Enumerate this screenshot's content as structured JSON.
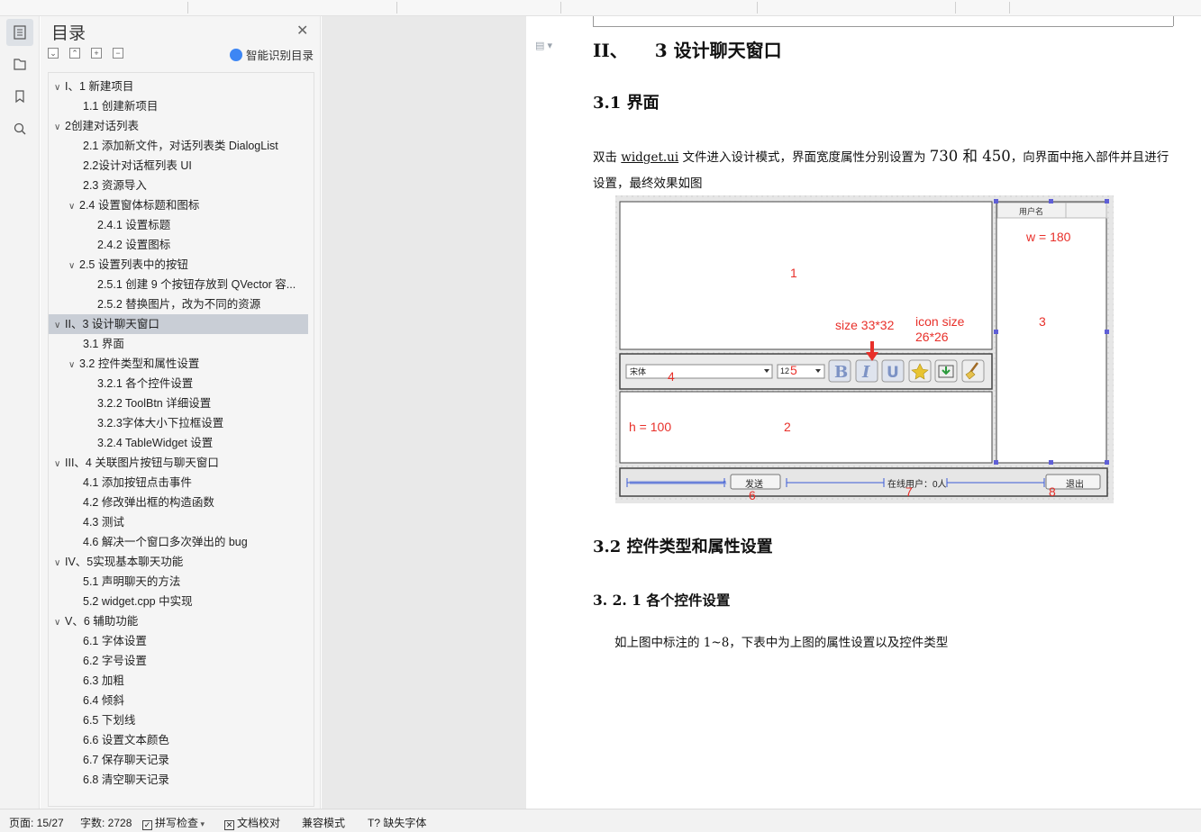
{
  "toc": {
    "title": "目录",
    "smart_toc_label": "智能识别目录",
    "items": [
      {
        "label": "I、1  新建项目",
        "level": 0,
        "expandable": true,
        "active": false
      },
      {
        "label": "1.1  创建新项目",
        "level": 1,
        "expandable": false,
        "active": false
      },
      {
        "label": "2创建对话列表",
        "level": 0,
        "expandable": true,
        "active": false
      },
      {
        "label": "2.1  添加新文件，对话列表类 DialogList",
        "level": 1,
        "expandable": false,
        "active": false
      },
      {
        "label": "2.2设计对话框列表 UI",
        "level": 1,
        "expandable": false,
        "active": false
      },
      {
        "label": "2.3  资源导入",
        "level": 1,
        "expandable": false,
        "active": false
      },
      {
        "label": "2.4  设置窗体标题和图标",
        "level": 1,
        "expandable": true,
        "active": false
      },
      {
        "label": "2.4.1 设置标题",
        "level": 2,
        "expandable": false,
        "active": false
      },
      {
        "label": "2.4.2  设置图标",
        "level": 2,
        "expandable": false,
        "active": false
      },
      {
        "label": "2.5 设置列表中的按钮",
        "level": 1,
        "expandable": true,
        "active": false
      },
      {
        "label": "2.5.1  创建 9 个按钮存放到 QVector 容...",
        "level": 2,
        "expandable": false,
        "active": false
      },
      {
        "label": "2.5.2  替换图片，改为不同的资源",
        "level": 2,
        "expandable": false,
        "active": false
      },
      {
        "label": "II、3  设计聊天窗口",
        "level": 0,
        "expandable": true,
        "active": true
      },
      {
        "label": "3.1  界面",
        "level": 1,
        "expandable": false,
        "active": false
      },
      {
        "label": "3.2  控件类型和属性设置",
        "level": 1,
        "expandable": true,
        "active": false
      },
      {
        "label": "3.2.1  各个控件设置",
        "level": 2,
        "expandable": false,
        "active": false
      },
      {
        "label": "3.2.2 ToolBtn 详细设置",
        "level": 2,
        "expandable": false,
        "active": false
      },
      {
        "label": "3.2.3字体大小下拉框设置",
        "level": 2,
        "expandable": false,
        "active": false
      },
      {
        "label": "3.2.4 TableWidget 设置",
        "level": 2,
        "expandable": false,
        "active": false
      },
      {
        "label": "III、4  关联图片按钮与聊天窗口",
        "level": 0,
        "expandable": true,
        "active": false
      },
      {
        "label": "4.1  添加按钮点击事件",
        "level": 1,
        "expandable": false,
        "active": false
      },
      {
        "label": "4.2  修改弹出框的构造函数",
        "level": 1,
        "expandable": false,
        "active": false
      },
      {
        "label": "4.3  测试",
        "level": 1,
        "expandable": false,
        "active": false
      },
      {
        "label": "4.6  解决一个窗口多次弹出的 bug",
        "level": 1,
        "expandable": false,
        "active": false
      },
      {
        "label": "IV、5实现基本聊天功能",
        "level": 0,
        "expandable": true,
        "active": false
      },
      {
        "label": "5.1  声明聊天的方法",
        "level": 1,
        "expandable": false,
        "active": false
      },
      {
        "label": "5.2 widget.cpp 中实现",
        "level": 1,
        "expandable": false,
        "active": false
      },
      {
        "label": "V、6  辅助功能",
        "level": 0,
        "expandable": true,
        "active": false
      },
      {
        "label": "6.1  字体设置",
        "level": 1,
        "expandable": false,
        "active": false
      },
      {
        "label": "6.2  字号设置",
        "level": 1,
        "expandable": false,
        "active": false
      },
      {
        "label": "6.3  加粗",
        "level": 1,
        "expandable": false,
        "active": false
      },
      {
        "label": "6.4  倾斜",
        "level": 1,
        "expandable": false,
        "active": false
      },
      {
        "label": "6.5 下划线",
        "level": 1,
        "expandable": false,
        "active": false
      },
      {
        "label": "6.6  设置文本颜色",
        "level": 1,
        "expandable": false,
        "active": false
      },
      {
        "label": "6.7  保存聊天记录",
        "level": 1,
        "expandable": false,
        "active": false
      },
      {
        "label": "6.8  清空聊天记录",
        "level": 1,
        "expandable": false,
        "active": false
      }
    ]
  },
  "document": {
    "h1_num": "II、",
    "h1_title": "3  设计聊天窗口",
    "h2_a": "3.1  界面",
    "para_before": "双击 ",
    "para_link": "widget.ui",
    "para_mid1": " 文件进入设计模式，界面宽度属性分别设置为 ",
    "para_w": "730",
    "para_and": " 和 ",
    "para_h": "450",
    "para_after": "，向界面中拖入部件并且进行设置，最终效果如图",
    "h2_b": "3.2  控件类型和属性设置",
    "h3_a": "3. 2. 1  各个控件设置",
    "para2": "如上图中标注的 1~8，下表中为上图的属性设置以及控件类型"
  },
  "figure": {
    "col_header": "用户名",
    "font_combo": "宋体",
    "size_combo": "12",
    "send_button": "发送",
    "online_label": "在线用户：0人",
    "exit_button": "退出",
    "ann_w": "w = 180",
    "ann_size": "size 33*32",
    "ann_icon1": "icon size",
    "ann_icon2": "26*26",
    "ann_h": "h = 100",
    "n1": "1",
    "n2": "2",
    "n3": "3",
    "n4": "4",
    "n5": "5",
    "n6": "6",
    "n7": "7",
    "n8": "8",
    "annotation_color": "#e8302a"
  },
  "status": {
    "page": "页面: 15/27",
    "words": "字数: 2728",
    "spell": "拼写检查",
    "proof": "文档校对",
    "compat": "兼容模式",
    "missing_font": "缺失字体"
  }
}
